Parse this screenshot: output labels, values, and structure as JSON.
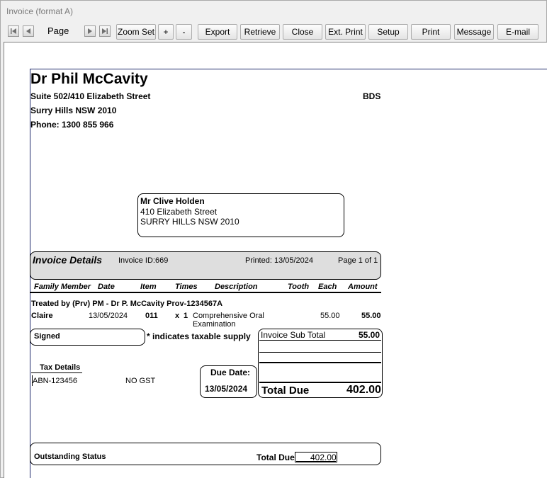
{
  "window": {
    "title": "Invoice (format A)"
  },
  "toolbar": {
    "page_label": "Page",
    "buttons": {
      "zoom_set": "Zoom Set",
      "zoom_in": "+",
      "zoom_out": "-",
      "export": "Export",
      "retrieve": "Retrieve",
      "close": "Close",
      "ext_print": "Ext. Print",
      "setup": "Setup",
      "print": "Print",
      "message": "Message",
      "email": "E-mail"
    }
  },
  "practice": {
    "doctor": "Dr Phil McCavity",
    "address1": "Suite 502/410 Elizabeth Street",
    "address2": "Surry Hills NSW 2010",
    "phone": "Phone: 1300 855 966",
    "qualification": "BDS"
  },
  "patient_address": {
    "name": "Mr Clive  Holden",
    "street": "410 Elizabeth Street",
    "suburb": "SURRY HILLS NSW 2010"
  },
  "invoice": {
    "title": "Invoice Details",
    "id": "Invoice ID:669",
    "printed": "Printed: 13/05/2024",
    "page": "Page 1 of 1"
  },
  "columns": {
    "family_member": "Family Member",
    "date": "Date",
    "item": "Item",
    "times": "Times",
    "description": "Description",
    "tooth": "Tooth",
    "each": "Each",
    "amount": "Amount"
  },
  "treated_by": "Treated by (Prv) PM - Dr P. McCavity Prov-1234567A",
  "line_items": [
    {
      "member": "Claire",
      "date": "13/05/2024",
      "item": "011",
      "times_x": "x",
      "times": "1",
      "description_1": "Comprehensive Oral",
      "description_2": "Examination",
      "each": "55.00",
      "amount": "55.00"
    }
  ],
  "signed_label": "Signed",
  "taxable_note": "* indicates taxable supply",
  "subtotal": {
    "label": "Invoice Sub Total",
    "value": "55.00"
  },
  "tax": {
    "heading": "Tax Details",
    "abn": "ABN-123456",
    "gst": "NO GST"
  },
  "due": {
    "label": "Due Date:",
    "date": "13/05/2024"
  },
  "total_due": {
    "label": "Total Due",
    "value": "402.00"
  },
  "outstanding": {
    "label": "Outstanding Status",
    "total_label": "Total Due",
    "total_value": "402.00"
  }
}
